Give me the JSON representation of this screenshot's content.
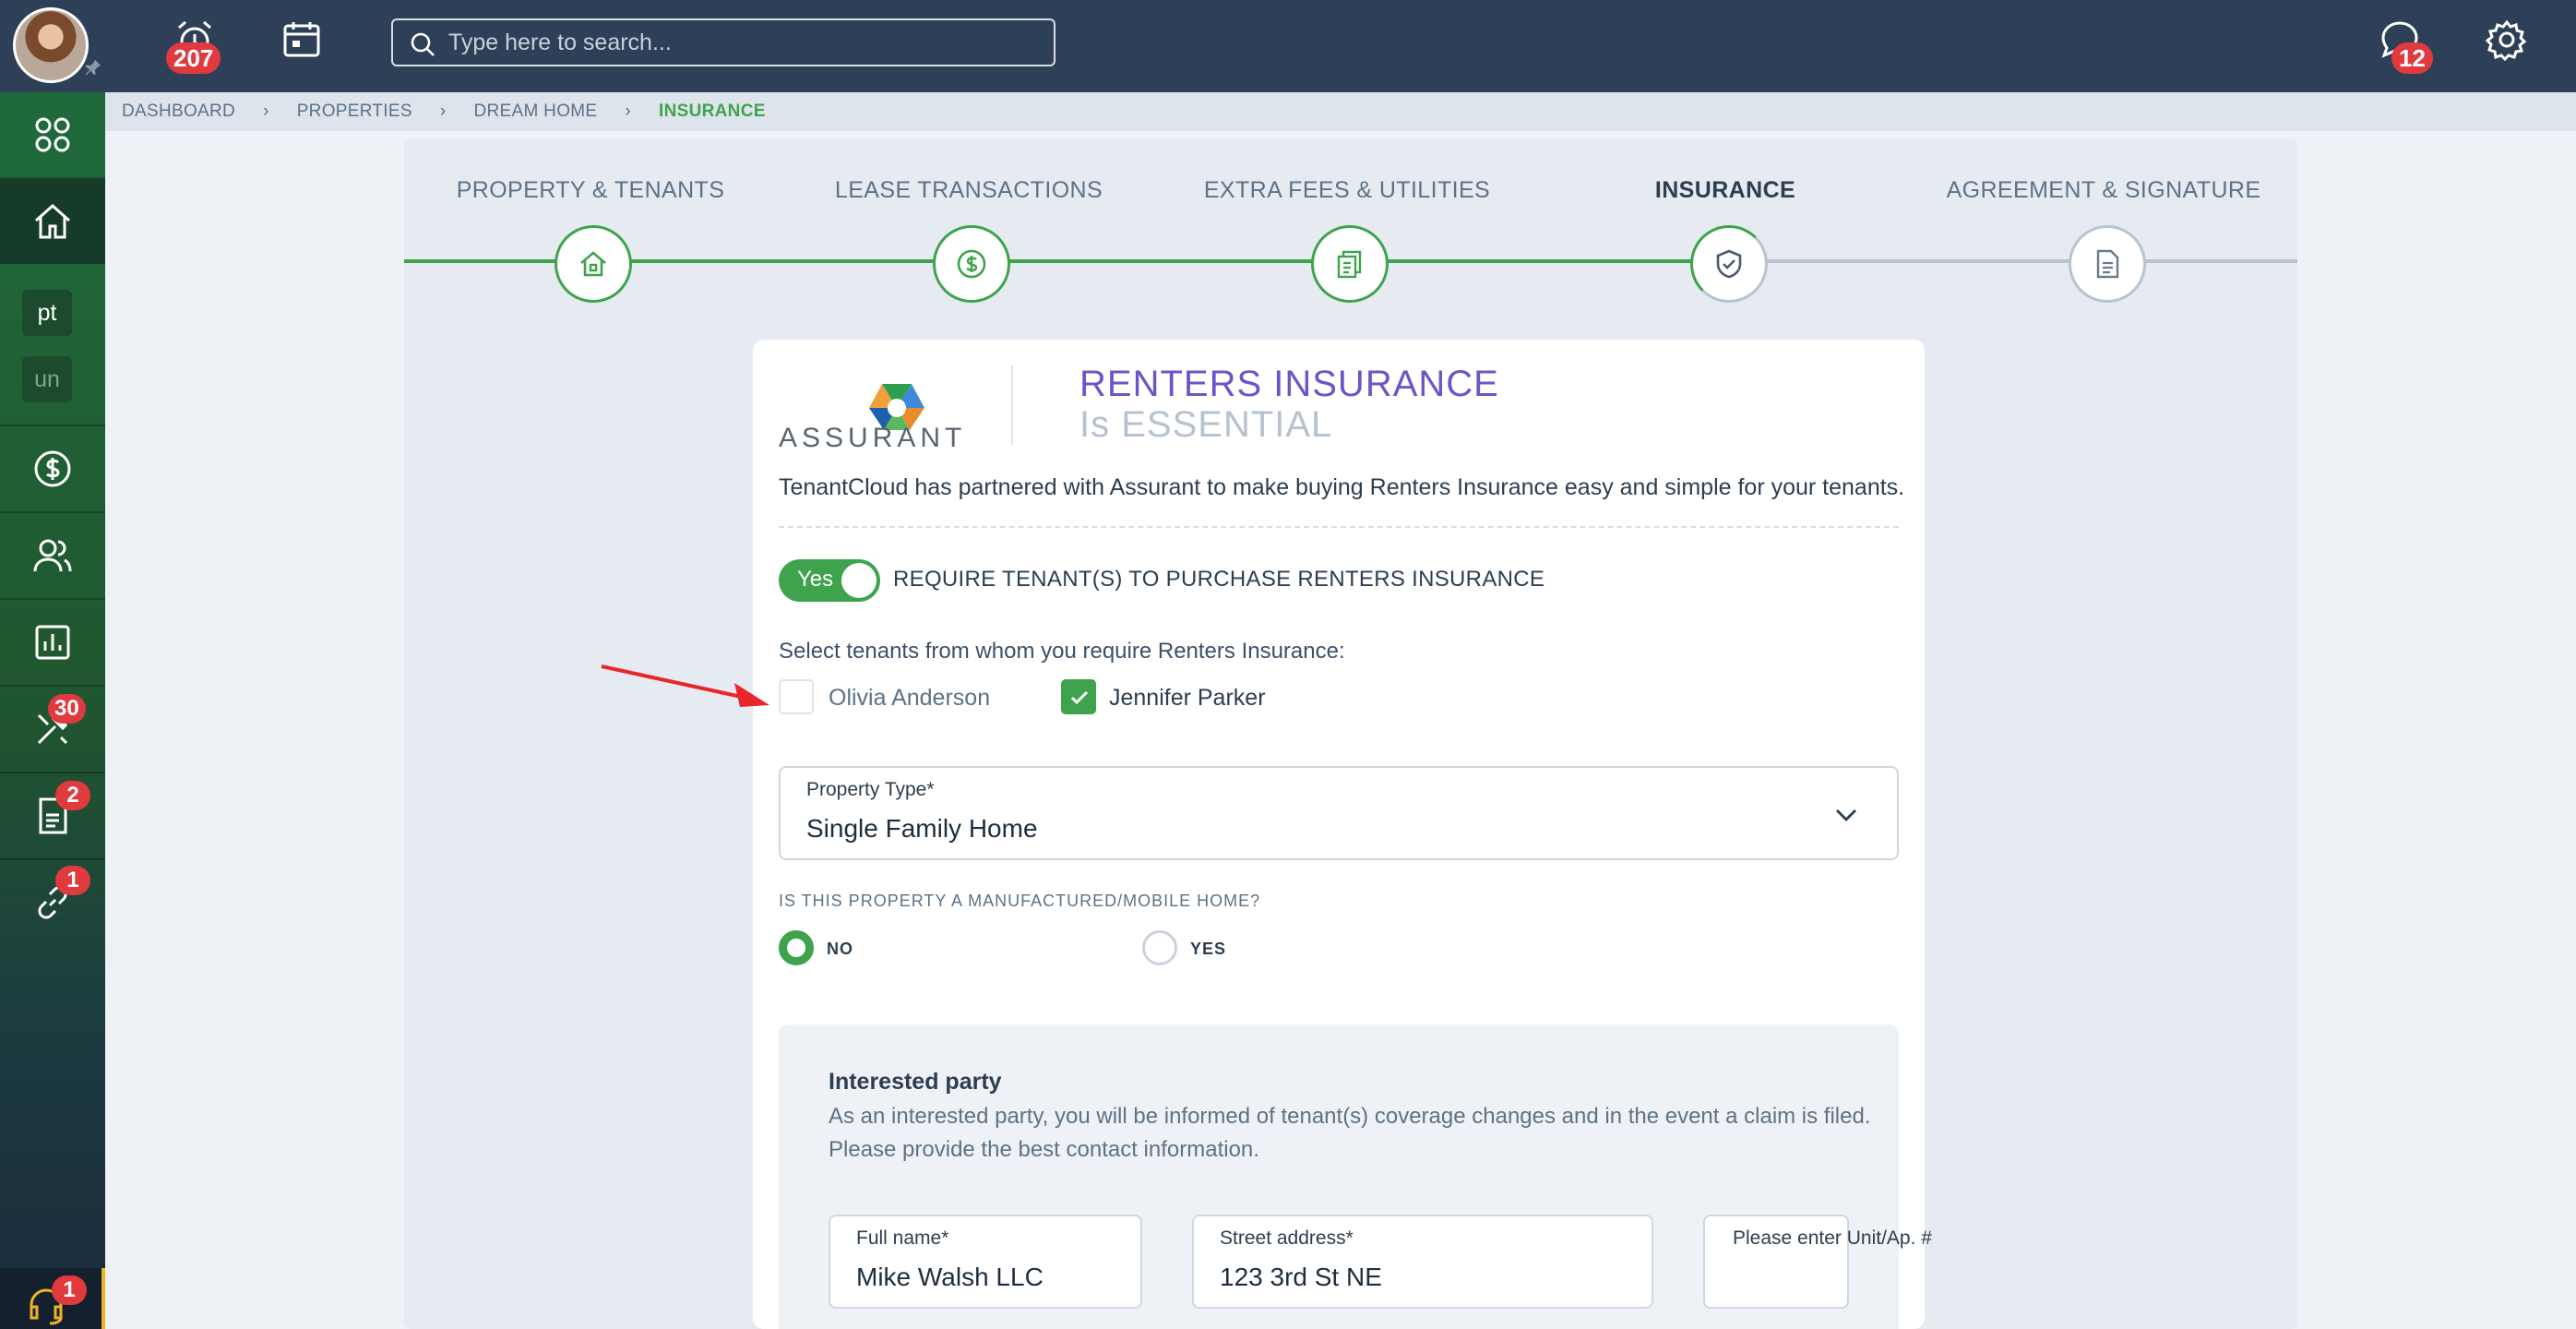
{
  "topbar": {
    "alarm_badge": "207",
    "messages_badge": "12",
    "search": {
      "placeholder": "Type here to search..."
    }
  },
  "sidebar": {
    "chips": [
      "pt",
      "un"
    ],
    "badges": {
      "maintenance": "30",
      "documents": "2",
      "links": "1",
      "support": "1"
    }
  },
  "breadcrumb": [
    "DASHBOARD",
    "PROPERTIES",
    "DREAM HOME",
    "INSURANCE"
  ],
  "stepper": {
    "steps": [
      {
        "label": "PROPERTY & TENANTS",
        "icon": "house-icon",
        "state": "done"
      },
      {
        "label": "LEASE TRANSACTIONS",
        "icon": "dollar-icon",
        "state": "done"
      },
      {
        "label": "EXTRA FEES & UTILITIES",
        "icon": "bills-icon",
        "state": "done"
      },
      {
        "label": "INSURANCE",
        "icon": "shield-check-icon",
        "state": "active"
      },
      {
        "label": "AGREEMENT & SIGNATURE",
        "icon": "document-icon",
        "state": "todo"
      }
    ],
    "accent": "#3fa34d"
  },
  "insurance": {
    "brand": "ASSURANT",
    "title": "RENTERS INSURANCE",
    "subtitle": "Is ESSENTIAL",
    "intro": "TenantCloud has partnered with Assurant to make buying Renters Insurance easy and simple for your tenants.",
    "toggle": {
      "value": "Yes",
      "label": "REQUIRE TENANT(S) TO PURCHASE RENTERS INSURANCE"
    },
    "select_question": "Select tenants from whom you require Renters Insurance:",
    "tenants": [
      {
        "name": "Olivia Anderson",
        "checked": false
      },
      {
        "name": "Jennifer Parker",
        "checked": true
      }
    ],
    "property_type": {
      "label": "Property Type*",
      "value": "Single Family Home"
    },
    "mobile_home": {
      "question": "IS THIS PROPERTY A MANUFACTURED/MOBILE HOME?",
      "options": [
        "NO",
        "YES"
      ],
      "selected": "NO"
    },
    "interested_party": {
      "title": "Interested party",
      "description": "As an interested party, you will be informed of tenant(s) coverage changes and in the event a claim is filed. Please provide the best contact information.",
      "full_name": {
        "label": "Full name*",
        "value": "Mike Walsh LLC"
      },
      "street": {
        "label": "Street address*",
        "value": "123 3rd St NE"
      },
      "unit": {
        "label": "Please enter Unit/Ap. #",
        "value": ""
      }
    }
  }
}
